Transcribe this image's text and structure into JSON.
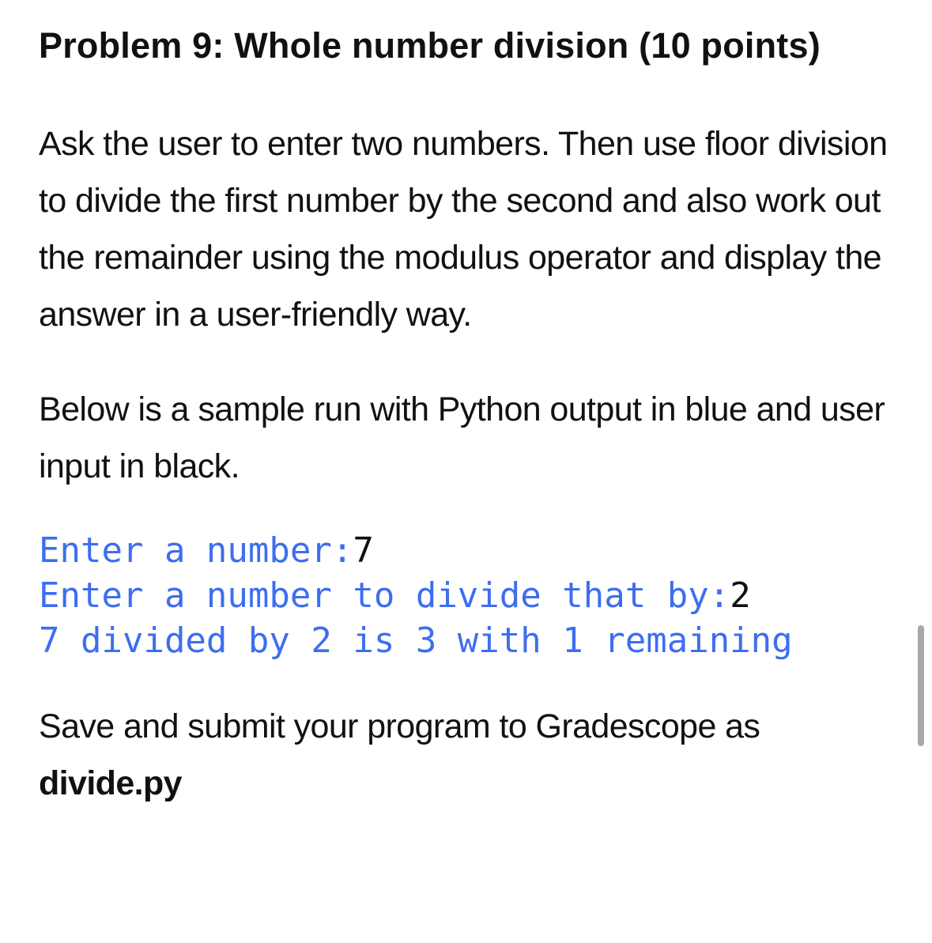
{
  "title": "Problem 9: Whole number division (10 points)",
  "paragraphs": {
    "instructions": "Ask the user to enter two numbers.  Then use floor division to divide the first number by the second and also work out the remainder using the modulus operator and display the answer in a user-friendly way.",
    "sample_intro": "Below is a sample run with Python output in blue and user input in black.",
    "submit_text": "Save and submit your program to Gradescope as",
    "filename": "divide.py"
  },
  "sample_run": {
    "lines": [
      {
        "output": "Enter a number:",
        "input": "7"
      },
      {
        "output": "Enter a number to divide that by:",
        "input": "2"
      },
      {
        "output": "7 divided by 2 is 3 with 1 remaining",
        "input": ""
      }
    ]
  },
  "colors": {
    "python_output": "#3d6ef0",
    "user_input": "#111111",
    "scrollbar": "#a8a8a8"
  }
}
